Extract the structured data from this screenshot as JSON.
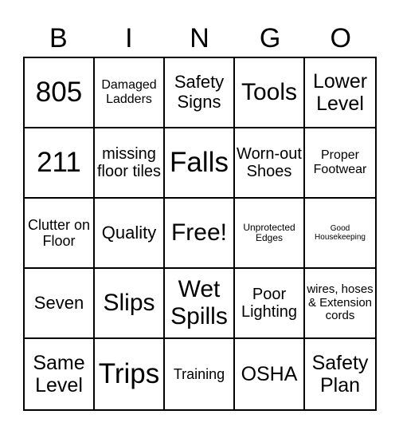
{
  "title_letters": [
    "B",
    "I",
    "N",
    "G",
    "O"
  ],
  "cells": [
    [
      "805",
      "Damaged Ladders",
      "Safety Signs",
      "Tools",
      "Lower Level"
    ],
    [
      "211",
      "missing floor tiles",
      "Falls",
      "Worn-out Shoes",
      "Proper Footwear"
    ],
    [
      "Clutter on Floor",
      "Quality",
      "Free!",
      "Unprotected Edges",
      "Good Housekeeping"
    ],
    [
      "Seven",
      "Slips",
      "Wet Spills",
      "Poor Lighting",
      "wires, hoses & Extension cords"
    ],
    [
      "Same Level",
      "Trips",
      "Training",
      "OSHA",
      "Safety Plan"
    ]
  ]
}
